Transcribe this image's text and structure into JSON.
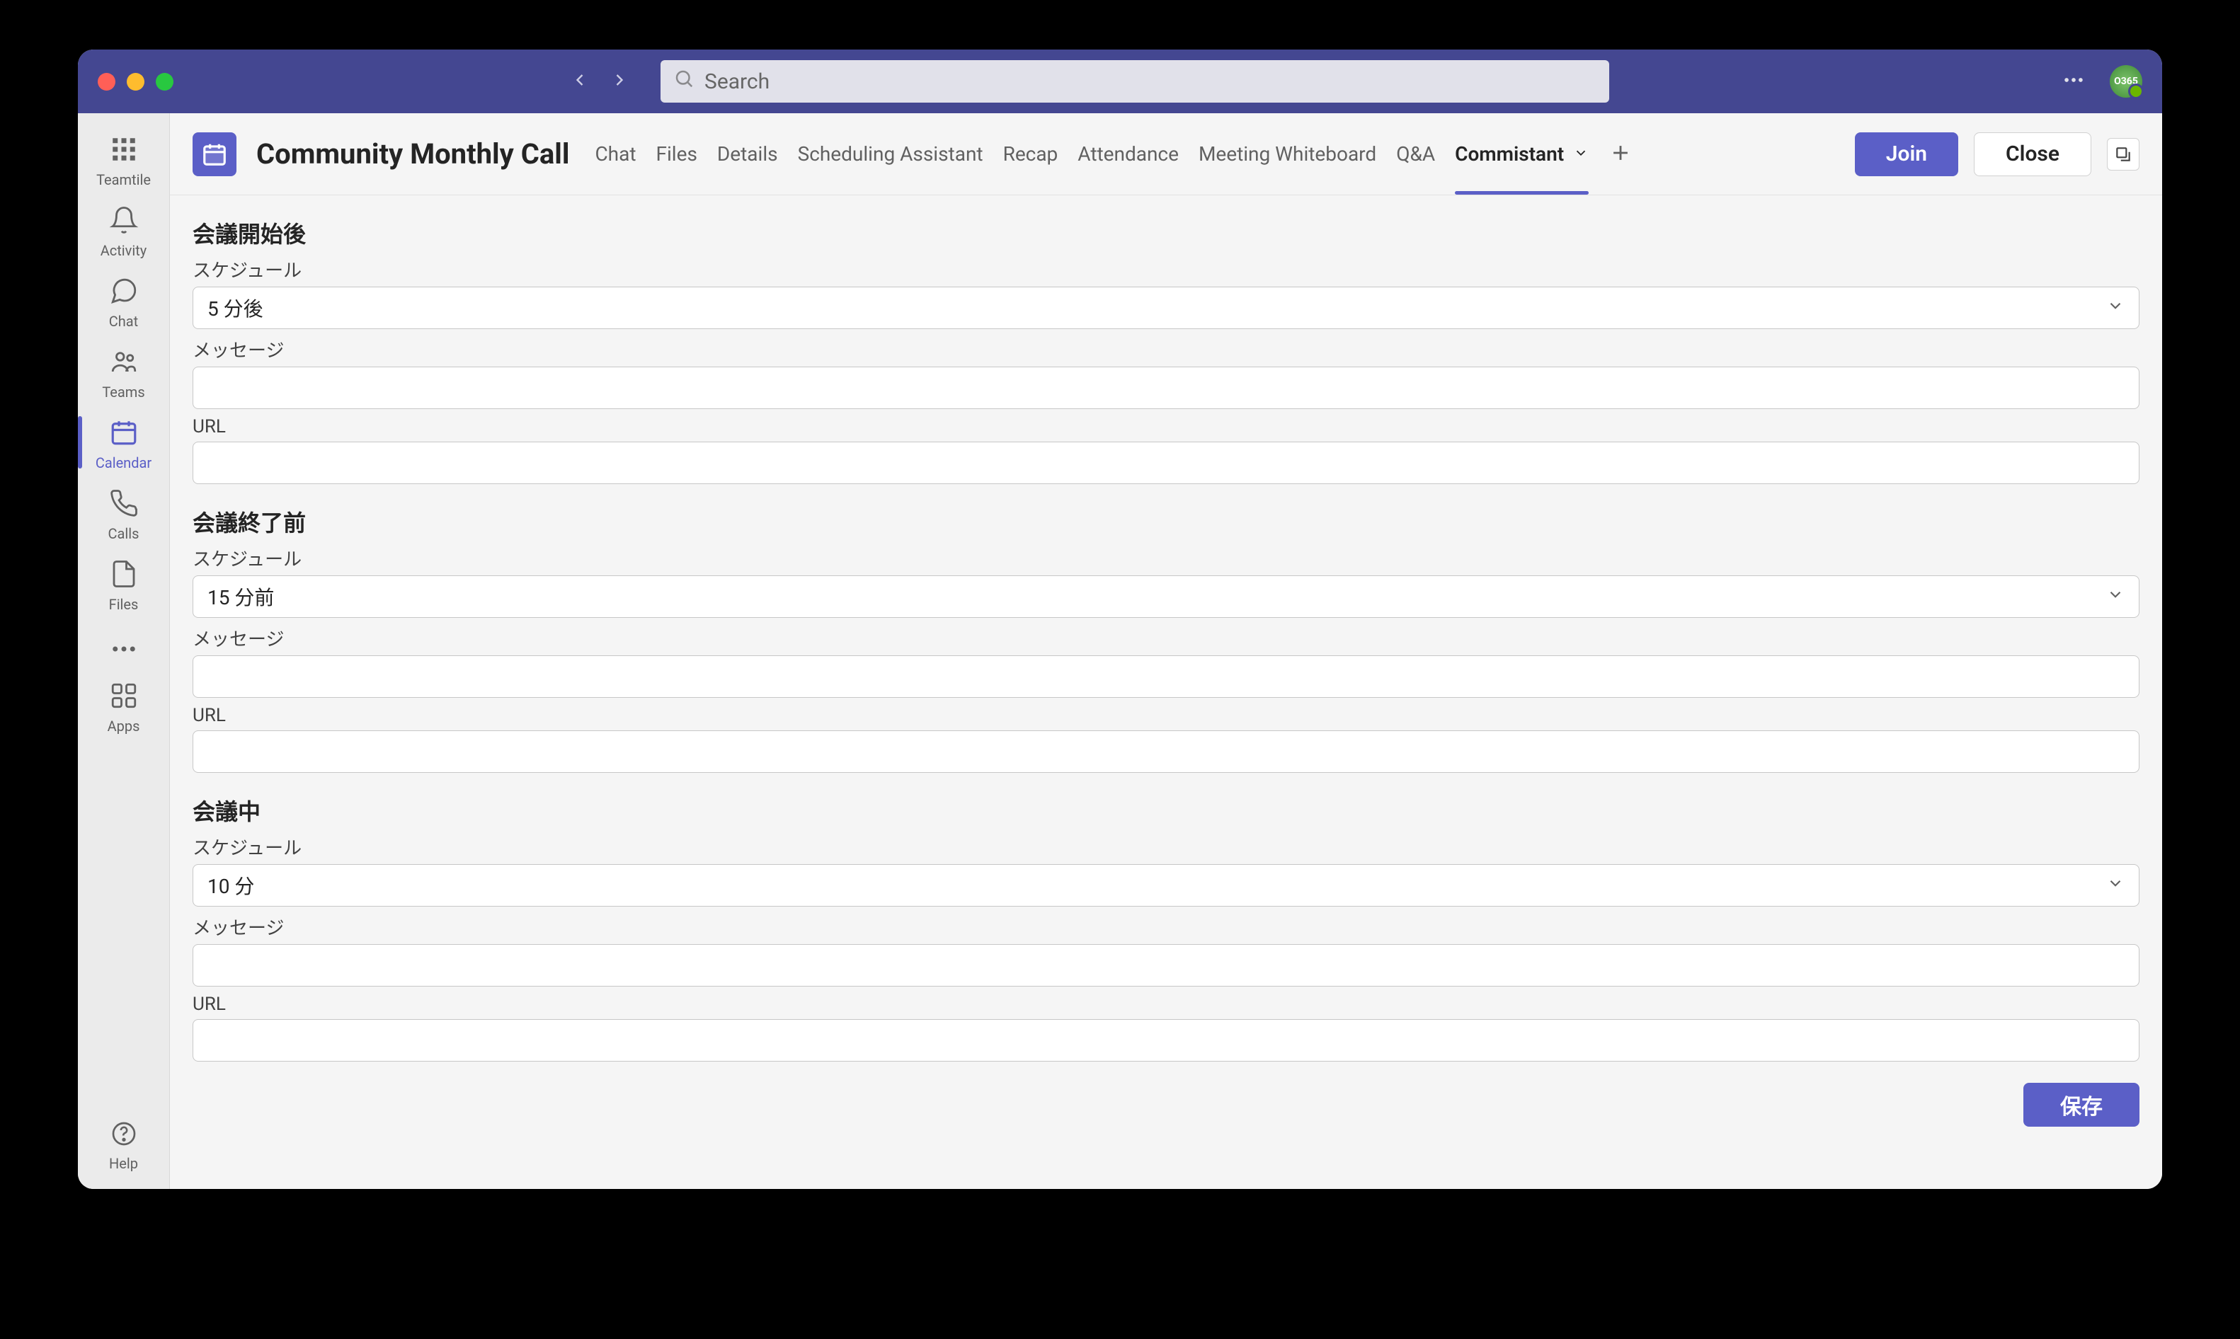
{
  "titlebar": {
    "search_placeholder": "Search"
  },
  "rail": {
    "items": [
      {
        "label": "Teamtile"
      },
      {
        "label": "Activity"
      },
      {
        "label": "Chat"
      },
      {
        "label": "Teams"
      },
      {
        "label": "Calendar"
      },
      {
        "label": "Calls"
      },
      {
        "label": "Files"
      }
    ],
    "apps_label": "Apps",
    "help_label": "Help"
  },
  "header": {
    "meeting_title": "Community Monthly Call",
    "tabs": [
      "Chat",
      "Files",
      "Details",
      "Scheduling Assistant",
      "Recap",
      "Attendance",
      "Meeting Whiteboard",
      "Q&A",
      "Commistant"
    ],
    "active_tab": "Commistant",
    "join_label": "Join",
    "close_label": "Close"
  },
  "sections": [
    {
      "title": "会議開始後",
      "schedule_label": "スケジュール",
      "schedule_value": "5 分後",
      "message_label": "メッセージ",
      "message_value": "",
      "url_label": "URL",
      "url_value": ""
    },
    {
      "title": "会議終了前",
      "schedule_label": "スケジュール",
      "schedule_value": "15 分前",
      "message_label": "メッセージ",
      "message_value": "",
      "url_label": "URL",
      "url_value": ""
    },
    {
      "title": "会議中",
      "schedule_label": "スケジュール",
      "schedule_value": "10 分",
      "message_label": "メッセージ",
      "message_value": "",
      "url_label": "URL",
      "url_value": ""
    }
  ],
  "footer": {
    "save_label": "保存"
  }
}
